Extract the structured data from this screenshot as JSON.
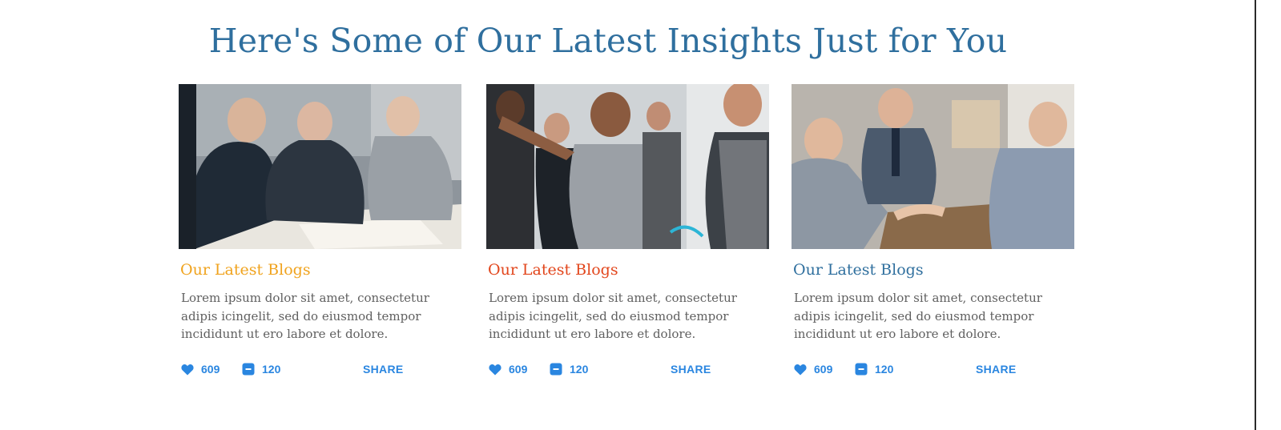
{
  "page": {
    "title": "Here's Some of Our Latest Insights Just for You"
  },
  "cards": [
    {
      "title": "Our Latest Blogs",
      "title_color": "#f0a31e",
      "text": "Lorem ipsum dolor sit amet, consectetur adipis icingelit, sed do eiusmod tempor incididunt ut ero labore et dolore.",
      "likes": "609",
      "comments": "120",
      "share": "SHARE",
      "image": "business-meeting-photo"
    },
    {
      "title": "Our Latest Blogs",
      "title_color": "#e2461c",
      "text": "Lorem ipsum dolor sit amet, consectetur adipis icingelit, sed do eiusmod tempor incididunt ut ero labore et dolore.",
      "likes": "609",
      "comments": "120",
      "share": "SHARE",
      "image": "team-presentation-photo"
    },
    {
      "title": "Our Latest Blogs",
      "title_color": "#2f6f9e",
      "text": "Lorem ipsum dolor sit amet, consectetur adipis icingelit, sed do eiusmod tempor incididunt ut ero labore et dolore.",
      "likes": "609",
      "comments": "120",
      "share": "SHARE",
      "image": "handshake-photo"
    }
  ],
  "icons": {
    "like": "heart-icon",
    "comment": "comment-icon"
  },
  "colors": {
    "accent": "#2a86e0",
    "heading": "#2f6f9e",
    "body_text": "#606060"
  }
}
